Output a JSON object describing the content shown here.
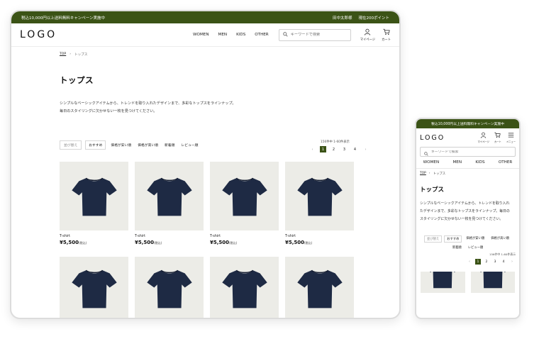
{
  "colors": {
    "accent": "#3b5316",
    "product_bg": "#ecece7",
    "shirt": "#1e2a44"
  },
  "promo": {
    "text": "税込10,000円以上送料無料キャンペーン実施中",
    "user": "田中太郎様",
    "points": "現在200ポイント"
  },
  "header": {
    "logo": "LOGO",
    "nav": [
      "WOMEN",
      "MEN",
      "KIDS",
      "OTHER"
    ],
    "search_placeholder": "キーワードで検索",
    "icons": [
      {
        "icon": "user-icon",
        "label": "マイページ"
      },
      {
        "icon": "cart-icon",
        "label": "カート"
      }
    ]
  },
  "breadcrumb": {
    "top": "TOP",
    "current": "トップス"
  },
  "page": {
    "title": "トップス",
    "description": [
      "シンプルなベーシックアイテムから、トレンドを取り入れたデザインまで、多彩なトップスをラインナップ。",
      "毎日のスタイリングに欠かせない一枚を見つけてください。"
    ]
  },
  "sort": {
    "label": "並び替え",
    "options": [
      "おすすめ",
      "価格が安い順",
      "価格が高い順",
      "新着順",
      "レビュー順"
    ]
  },
  "result_count": "156件中 1-60件表示",
  "pagination": {
    "prev": "‹",
    "pages": [
      "1",
      "2",
      "3",
      "4"
    ],
    "next": "›"
  },
  "products": [
    {
      "name": "T-shirt",
      "price": "¥5,500",
      "tax": "(税込)"
    },
    {
      "name": "T-shirt",
      "price": "¥5,500",
      "tax": "(税込)"
    },
    {
      "name": "T-shirt",
      "price": "¥5,500",
      "tax": "(税込)"
    },
    {
      "name": "T-shirt",
      "price": "¥5,500",
      "tax": "(税込)"
    }
  ],
  "mobile": {
    "promo": "税込10,000円以上送料無料キャンペーン実施中",
    "icons": [
      {
        "icon": "user-icon",
        "label": "マイページ"
      },
      {
        "icon": "cart-icon",
        "label": "カート"
      },
      {
        "icon": "menu-icon",
        "label": "メニュー"
      }
    ],
    "description": "シンプルなベーシックアイテムから、トレンドを取り入れたデザインまで、多彩なトップスをラインナップ。毎日のスタイリングに欠かせない一枚を見つけてください。"
  }
}
